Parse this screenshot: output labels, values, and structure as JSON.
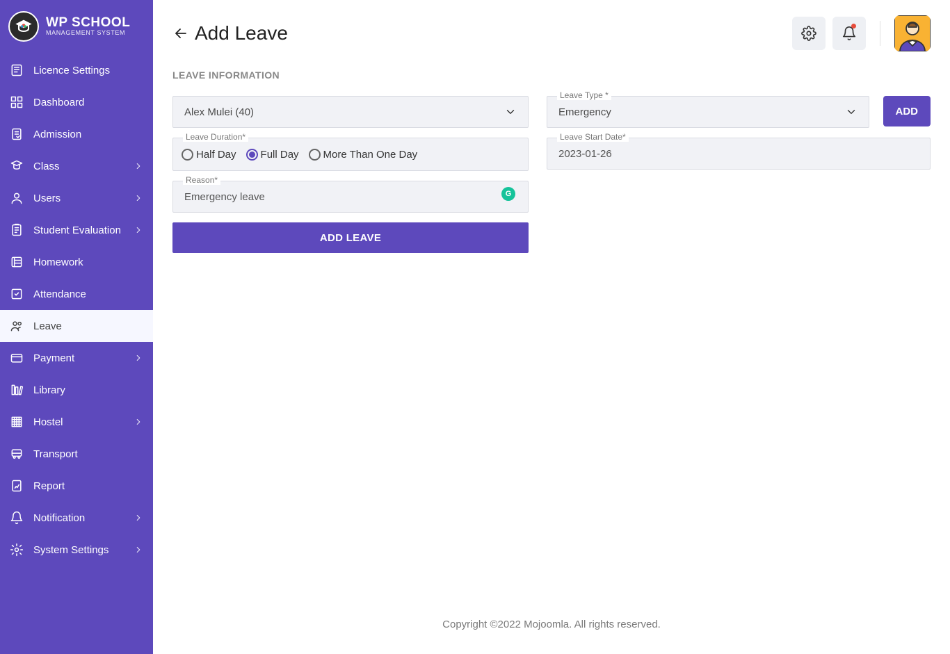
{
  "brand": {
    "line1": "WP SCHOOL",
    "line2": "MANAGEMENT SYSTEM"
  },
  "sidebar": {
    "items": [
      {
        "label": "Licence Settings",
        "icon": "licence",
        "chev": false
      },
      {
        "label": "Dashboard",
        "icon": "dashboard",
        "chev": false
      },
      {
        "label": "Admission",
        "icon": "admission",
        "chev": false
      },
      {
        "label": "Class",
        "icon": "class",
        "chev": true
      },
      {
        "label": "Users",
        "icon": "users",
        "chev": true
      },
      {
        "label": "Student Evaluation",
        "icon": "evaluation",
        "chev": true
      },
      {
        "label": "Homework",
        "icon": "homework",
        "chev": false
      },
      {
        "label": "Attendance",
        "icon": "attendance",
        "chev": false
      },
      {
        "label": "Leave",
        "icon": "leave",
        "chev": false,
        "active": true
      },
      {
        "label": "Payment",
        "icon": "payment",
        "chev": true
      },
      {
        "label": "Library",
        "icon": "library",
        "chev": false
      },
      {
        "label": "Hostel",
        "icon": "hostel",
        "chev": true
      },
      {
        "label": "Transport",
        "icon": "transport",
        "chev": false
      },
      {
        "label": "Report",
        "icon": "report",
        "chev": false
      },
      {
        "label": "Notification",
        "icon": "notification",
        "chev": true
      },
      {
        "label": "System Settings",
        "icon": "settings",
        "chev": true
      }
    ]
  },
  "page": {
    "title": "Add Leave",
    "section": "LEAVE INFORMATION"
  },
  "form": {
    "student_select": "Alex Mulei (40)",
    "leave_type_label": "Leave Type *",
    "leave_type_value": "Emergency",
    "add_btn": "ADD",
    "duration_label": "Leave Duration*",
    "duration_options": [
      "Half Day",
      "Full Day",
      "More Than One Day"
    ],
    "duration_selected": "Full Day",
    "start_date_label": "Leave Start Date*",
    "start_date_value": "2023-01-26",
    "reason_label": "Reason*",
    "reason_value": "Emergency leave",
    "submit_label": "ADD LEAVE"
  },
  "footer": "Copyright ©2022 Mojoomla. All rights reserved."
}
